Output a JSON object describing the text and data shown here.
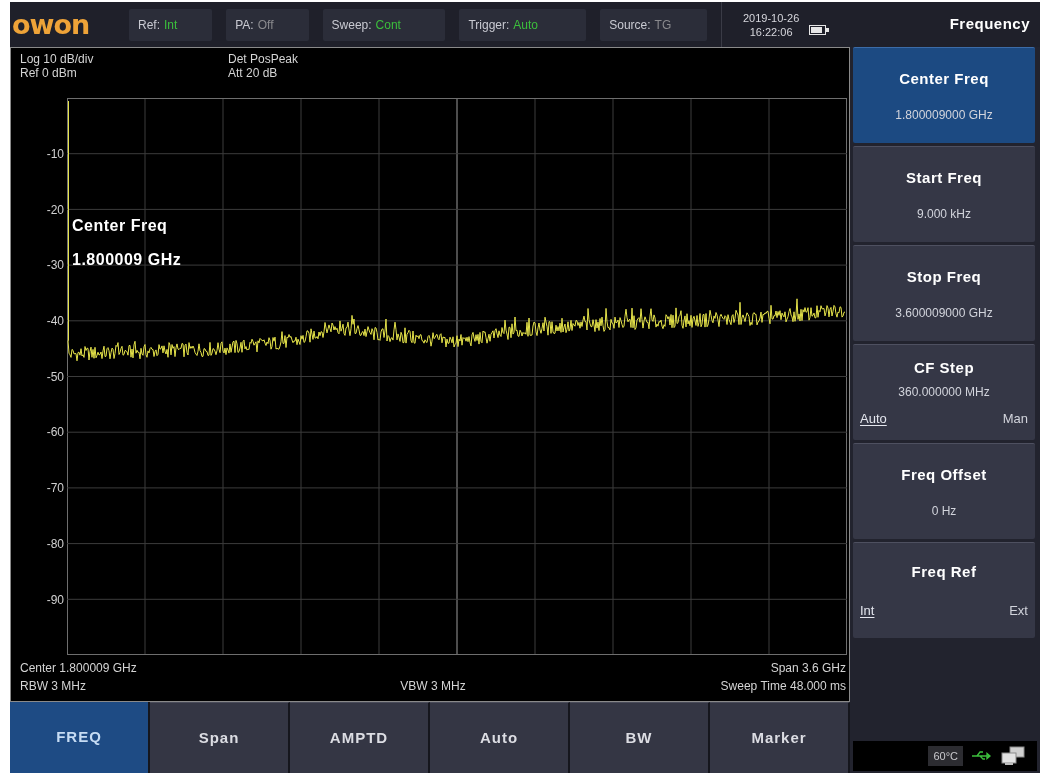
{
  "top_bar": {
    "logo": "owon",
    "indicators": [
      {
        "label": "Ref:",
        "value": "Int",
        "color": "#3cbf3c"
      },
      {
        "label": "PA:",
        "value": "Off",
        "color": "#8a8a8e"
      },
      {
        "label": "Sweep:",
        "value": "Cont",
        "color": "#3cbf3c"
      },
      {
        "label": "Trigger:",
        "value": "Auto",
        "color": "#3cbf3c"
      },
      {
        "label": "Source:",
        "value": "TG",
        "color": "#8a8a8e"
      }
    ],
    "date": "2019-10-26",
    "time": "16:22:06"
  },
  "display": {
    "scale": "Log 10 dB/div",
    "reference": "Ref 0 dBm",
    "detector": "Det PosPeak",
    "attenuation": "Att 20 dB",
    "y_labels": [
      "-10",
      "-20",
      "-30",
      "-40",
      "-50",
      "-60",
      "-70",
      "-80",
      "-90"
    ],
    "callout": {
      "title": "Center Freq",
      "value": "1.800009 GHz"
    },
    "center": "Center 1.800009 GHz",
    "span": "Span 3.6 GHz",
    "rbw": "RBW 3 MHz",
    "vbw": "VBW 3 MHz",
    "sweep_time": "Sweep Time 48.000 ms"
  },
  "softkeys": [
    {
      "label": "FREQ",
      "selected": true
    },
    {
      "label": "Span",
      "selected": false
    },
    {
      "label": "AMPTD",
      "selected": false
    },
    {
      "label": "Auto",
      "selected": false
    },
    {
      "label": "BW",
      "selected": false
    },
    {
      "label": "Marker",
      "selected": false
    }
  ],
  "menu": {
    "title": "Frequency",
    "items": [
      {
        "kind": "value",
        "label": "Center Freq",
        "value": "1.800009000 GHz",
        "selected": true
      },
      {
        "kind": "value",
        "label": "Start Freq",
        "value": "9.000 kHz",
        "selected": false
      },
      {
        "kind": "value",
        "label": "Stop Freq",
        "value": "3.600009000 GHz",
        "selected": false
      },
      {
        "kind": "choice",
        "label": "CF Step",
        "value": "360.000000 MHz",
        "selected": false,
        "options": [
          {
            "label": "Auto",
            "selected": true
          },
          {
            "label": "Man",
            "selected": false
          }
        ]
      },
      {
        "kind": "value",
        "label": "Freq Offset",
        "value": "0 Hz",
        "selected": false
      },
      {
        "kind": "choice",
        "label": "Freq Ref",
        "selected": false,
        "options": [
          {
            "label": "Int",
            "selected": true
          },
          {
            "label": "Ext",
            "selected": false
          }
        ]
      }
    ]
  },
  "status_bar": {
    "temperature": "60°C"
  }
}
